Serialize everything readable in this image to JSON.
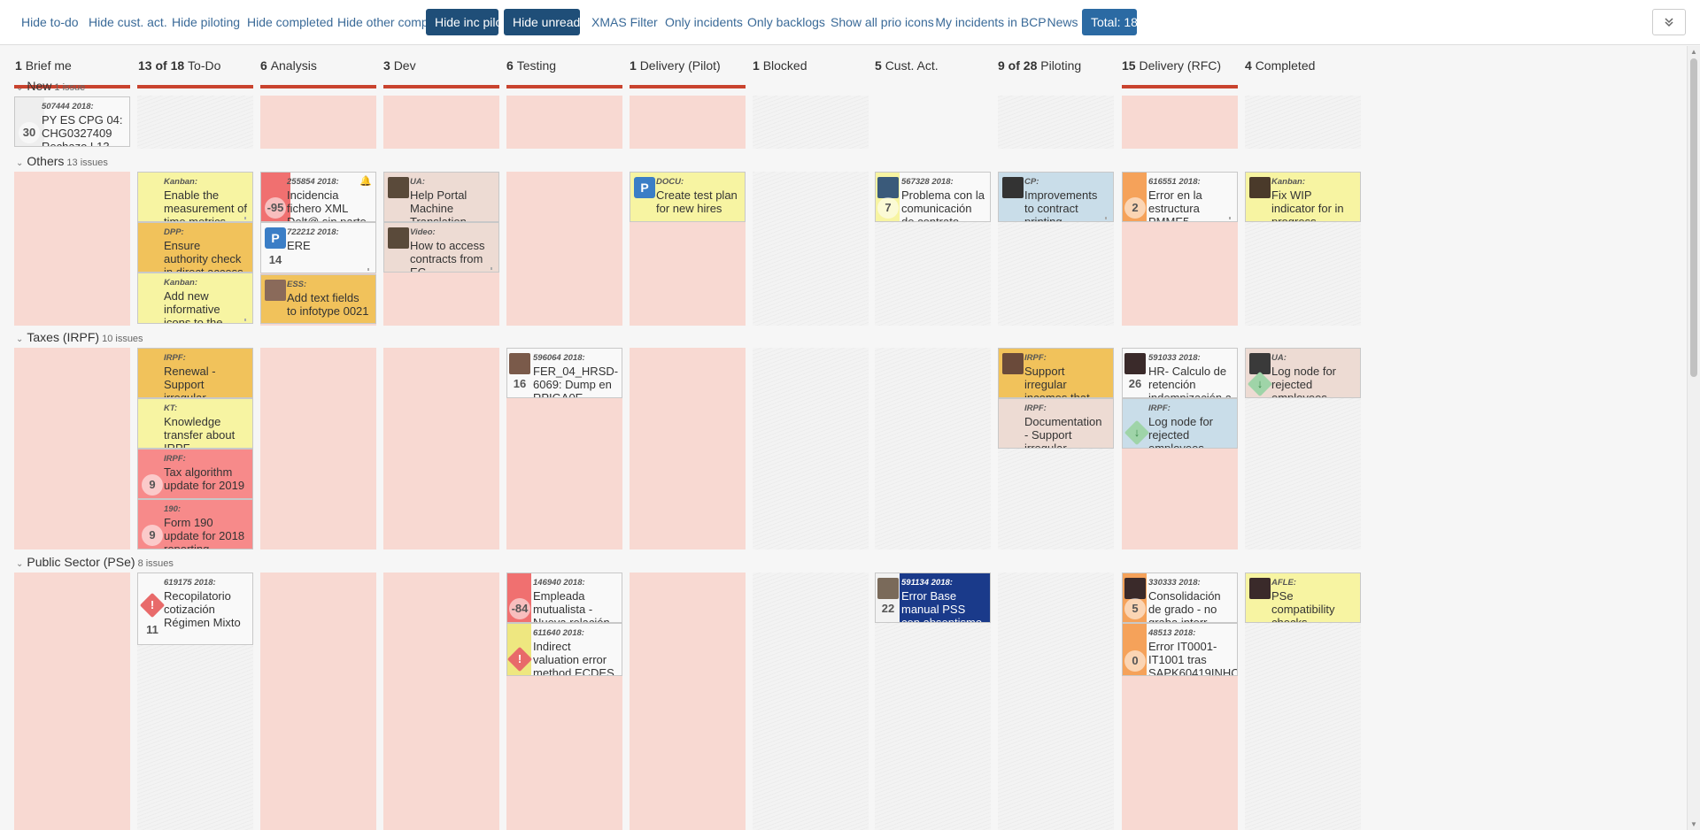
{
  "toolbar": {
    "buttons": [
      {
        "label": "Hide to-do"
      },
      {
        "label": "Hide cust. act."
      },
      {
        "label": "Hide piloting"
      },
      {
        "label": "Hide completed"
      },
      {
        "label": "Hide other comp."
      },
      {
        "label": "Hide inc pilot"
      },
      {
        "label": "Hide unready"
      },
      {
        "label": "XMAS Filter"
      },
      {
        "label": "Only incidents"
      },
      {
        "label": "Only backlogs"
      },
      {
        "label": "Show all prio icons"
      },
      {
        "label": "My incidents in BCP"
      },
      {
        "label": "News"
      },
      {
        "label": "Total: 18"
      }
    ],
    "expand_icon": "chevron-double-down-icon"
  },
  "columns": [
    {
      "count": "1",
      "name": "Brief me"
    },
    {
      "count": "13 of 18",
      "name": "To-Do"
    },
    {
      "count": "6",
      "name": "Analysis"
    },
    {
      "count": "3",
      "name": "Dev"
    },
    {
      "count": "6",
      "name": "Testing"
    },
    {
      "count": "1",
      "name": "Delivery (Pilot)"
    },
    {
      "count": "1",
      "name": "Blocked"
    },
    {
      "count": "5",
      "name": "Cust. Act."
    },
    {
      "count": "9 of 28",
      "name": "Piloting"
    },
    {
      "count": "15",
      "name": "Delivery (RFC)"
    },
    {
      "count": "4",
      "name": "Completed"
    }
  ],
  "lanes": [
    {
      "name": "New",
      "count": "1 issue"
    },
    {
      "name": "Others",
      "count": "13 issues"
    },
    {
      "name": "Taxes (IRPF)",
      "count": "10 issues"
    },
    {
      "name": "Public Sector (PSe)",
      "count": "8 issues"
    }
  ],
  "cards": [
    {
      "label": "507444 2018:",
      "title": "PY ES CPG 04: CHG0327409 Rechazo L13 por",
      "num": "30"
    },
    {
      "label": "Kanban:",
      "title": "Enable the measurement of time metrics"
    },
    {
      "label": "DPP:",
      "title": "Ensure authority check in direct access to PA*"
    },
    {
      "label": "Kanban:",
      "title": "Add new informative icons to the cards"
    },
    {
      "label": "255854 2018:",
      "title": "Incidencia fichero XML Delt@ sin parte d",
      "num": "-95"
    },
    {
      "label": "722212 2018:",
      "title": "ERE",
      "num": "14",
      "badge": "P"
    },
    {
      "label": "ESS:",
      "title": "Add text fields to infotype 0021"
    },
    {
      "label": "UA:",
      "title": "Help Portal Machine Translation"
    },
    {
      "label": "Video:",
      "title": "How to access contracts from EC"
    },
    {
      "label": "DOCU:",
      "title": "Create test plan for new hires",
      "badge": "P"
    },
    {
      "label": "567328 2018:",
      "title": "Problema con la comunicación de contrato",
      "num": "7"
    },
    {
      "label": "CP:",
      "title": "Improvements to contract printing"
    },
    {
      "label": "616551 2018:",
      "title": "Error en la estructura PMME5",
      "num": "2"
    },
    {
      "label": "Kanban:",
      "title": "Fix WIP indicator for in progress columns"
    },
    {
      "label": "IRPF:",
      "title": "Renewal - Support irregular incomes that are always"
    },
    {
      "label": "KT:",
      "title": "Knowledge transfer about IRPF"
    },
    {
      "label": "IRPF:",
      "title": "Tax algorithm update for 2019",
      "num": "9"
    },
    {
      "label": "190:",
      "title": "Form 190 update for 2018 reporting",
      "num": "9"
    },
    {
      "label": "596064 2018:",
      "title": "FER_04_HRSD-6069: Dump en RPIGA0E",
      "num": "16"
    },
    {
      "label": "IRPF:",
      "title": "Support irregular incomes that are always reduced"
    },
    {
      "label": "IRPF:",
      "title": "Documentation - Support irregular incomes that are"
    },
    {
      "label": "591033 2018:",
      "title": "HR- Calculo de retención indemnización a",
      "num": "26"
    },
    {
      "label": "IRPF:",
      "title": "Log node for rejected employees"
    },
    {
      "label": "UA:",
      "title": "Log node for rejected employees"
    },
    {
      "label": "619175 2018:",
      "title": "Recopilatorio cotización Régimen Mixto",
      "num": "11"
    },
    {
      "label": "146940 2018:",
      "title": "Empleada mutualista - Nueva relación",
      "num": "-84"
    },
    {
      "label": "611640 2018:",
      "title": "Indirect valuation error method ECDES"
    },
    {
      "label": "591134 2018:",
      "title": "Error Base manual PSS con absentismo pre",
      "num": "22"
    },
    {
      "label": "330333 2018:",
      "title": "Consolidación de grado - no graba interr",
      "num": "5"
    },
    {
      "label": "48513 2018:",
      "title": "Error IT0001-IT1001 tras SAPK60419INHCMP",
      "num": "0"
    },
    {
      "label": "AFLE:",
      "title": "PSe compatibility checks"
    }
  ],
  "colors": {
    "accent_bar": "#c9432e",
    "active_button": "#1f4e78",
    "link": "#3a6a98"
  }
}
